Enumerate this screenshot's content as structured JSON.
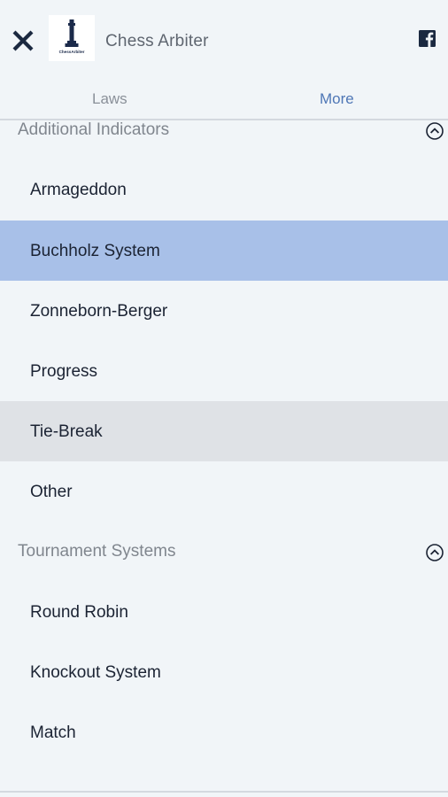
{
  "header": {
    "title": "Chess Arbiter",
    "logo_caption": "ChessArbiter",
    "close_icon": "close-icon",
    "facebook_icon": "facebook-icon"
  },
  "tabs": [
    {
      "label": "Laws",
      "active": false
    },
    {
      "label": "More",
      "active": true
    }
  ],
  "sections": [
    {
      "title": "Additional Indicators",
      "expanded": true,
      "items": [
        {
          "label": "Armageddon"
        },
        {
          "label": "Buchholz System",
          "state": "selected"
        },
        {
          "label": "Zonneborn-Berger"
        },
        {
          "label": "Progress"
        },
        {
          "label": "Tie-Break",
          "state": "hovered"
        },
        {
          "label": "Other"
        }
      ]
    },
    {
      "title": "Tournament Systems",
      "expanded": true,
      "items": [
        {
          "label": "Round Robin"
        },
        {
          "label": "Knockout System"
        },
        {
          "label": "Match"
        }
      ]
    }
  ],
  "colors": {
    "background": "#f1f5f8",
    "active_tab": "#4f77b6",
    "selected_row": "#a8c0e8",
    "hovered_row": "#dfe2e6",
    "item_text": "#1b2333"
  }
}
